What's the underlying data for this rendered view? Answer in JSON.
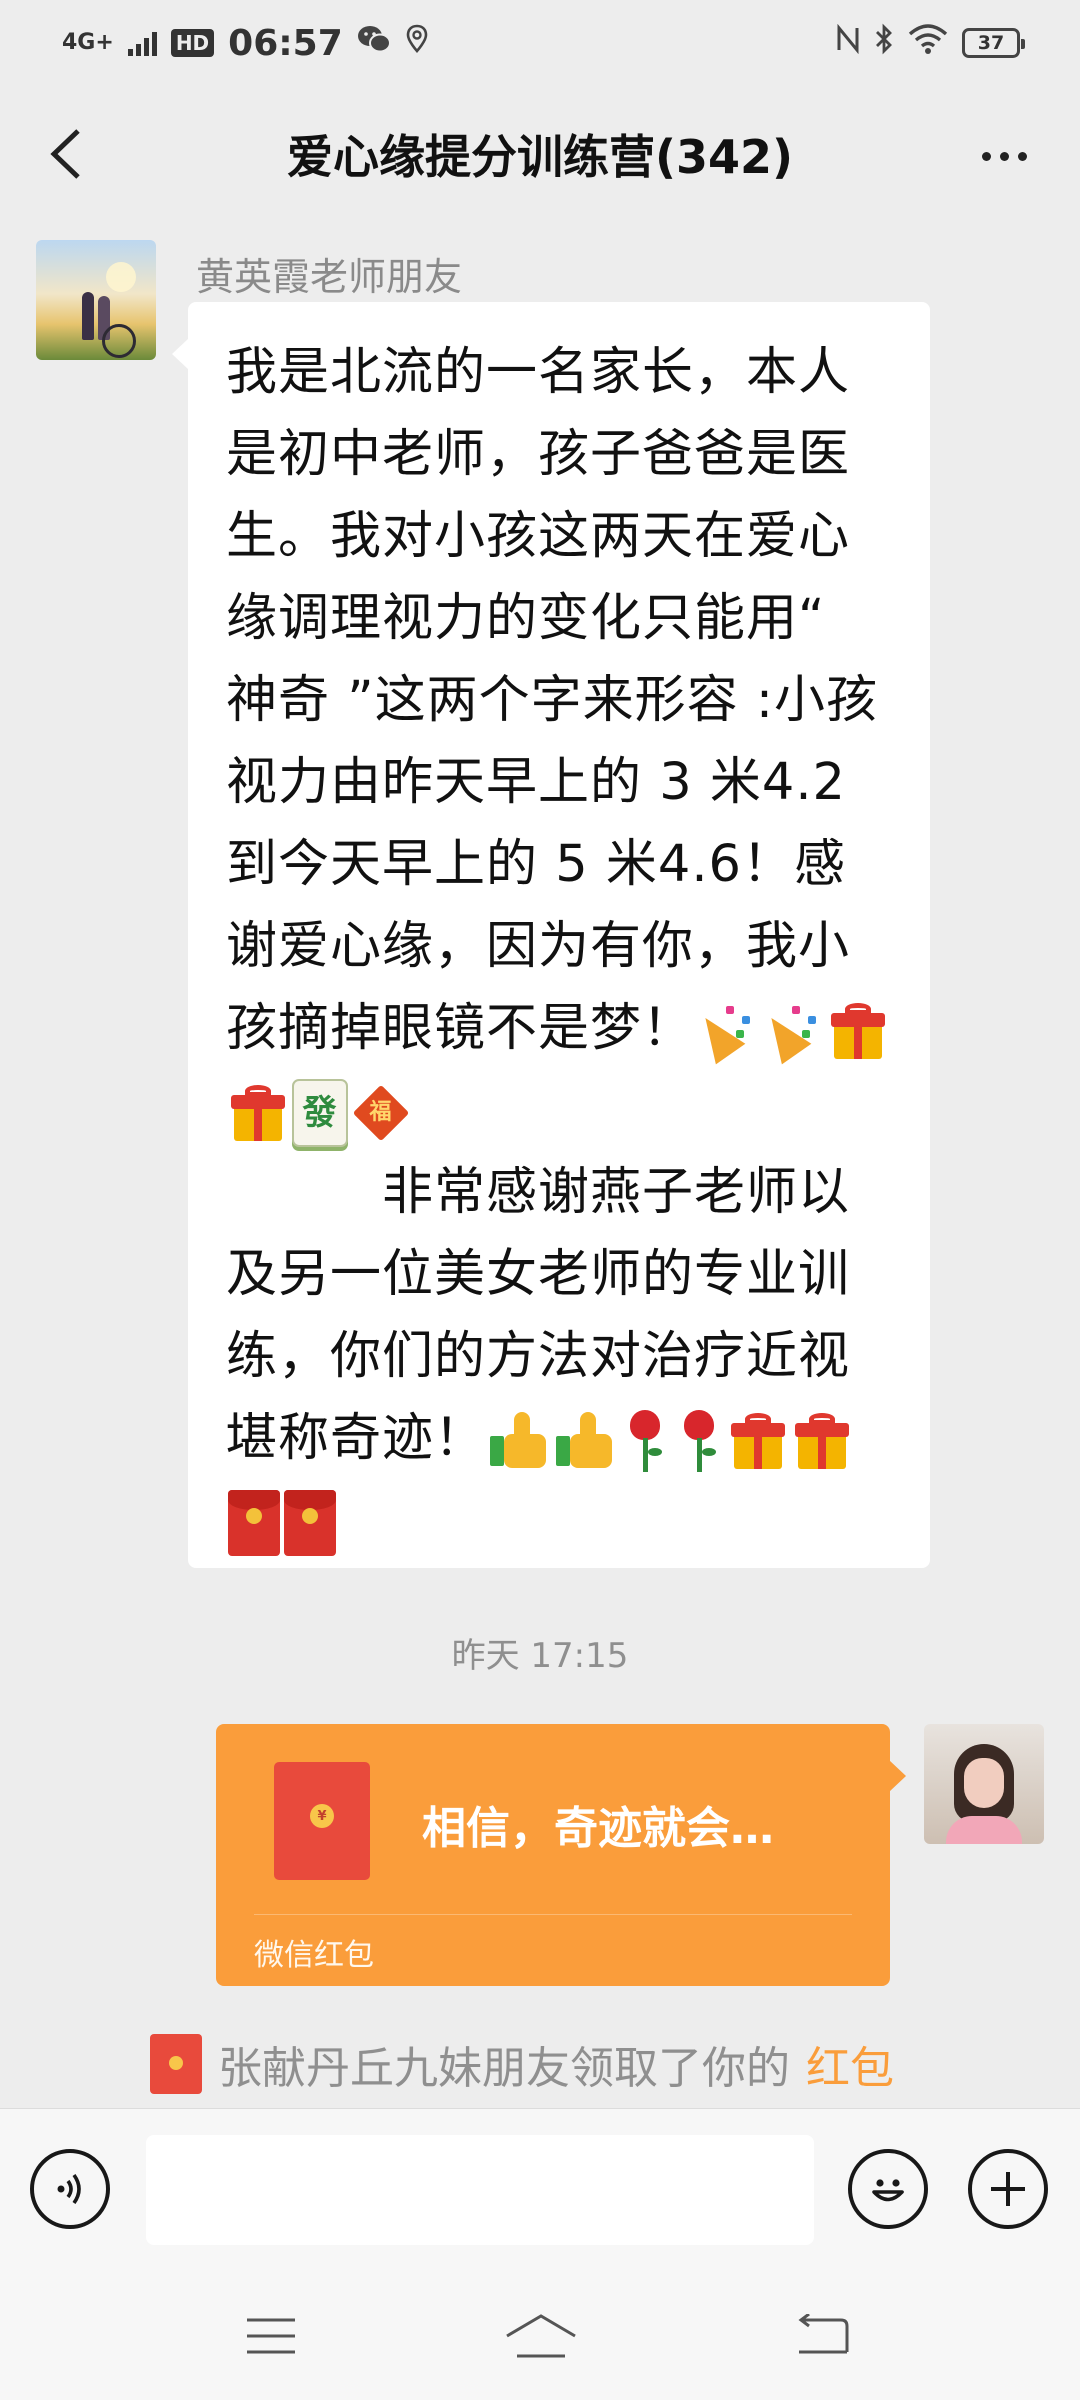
{
  "status_bar": {
    "network": "4G+",
    "hd": "HD",
    "time": "06:57",
    "battery": "37",
    "icons": [
      "signal-icon",
      "wechat-icon",
      "location-icon",
      "nfc-icon",
      "bluetooth-icon",
      "wifi-icon",
      "battery-icon"
    ]
  },
  "header": {
    "title": "爱心缘提分训练营(342)"
  },
  "messages": {
    "incoming": {
      "sender": "黄英霞老师朋友",
      "part1": "我是北流的一名家长，本人是初中老师，孩子爸爸是医生。我对小孩这两天在爱心缘调理视力的变化只能用“ 神奇 ”这两个字来形容 :小孩视力由昨天早上的 3 米4.2 到今天早上的 5 米4.6！感谢爱心缘，因为有你，我小孩摘掉眼镜不是梦！",
      "part2": "　　　非常感谢燕子老师以及另一位美女老师的专业训练，你们的方法对治疗近视堪称奇迹！",
      "mahjong_char": "發",
      "fu_char": "福"
    },
    "timestamp": "昨天 17:15",
    "red_packet": {
      "title": "相信，奇迹就会…",
      "label": "微信红包",
      "coin": "¥"
    },
    "notice": {
      "text": "张献丹丘九妹朋友领取了你的",
      "link": "红包"
    }
  },
  "colors": {
    "background": "#ededed",
    "red_packet": "#fa9d3b",
    "envelope": "#e84a3c",
    "link": "#fa9d3b"
  }
}
